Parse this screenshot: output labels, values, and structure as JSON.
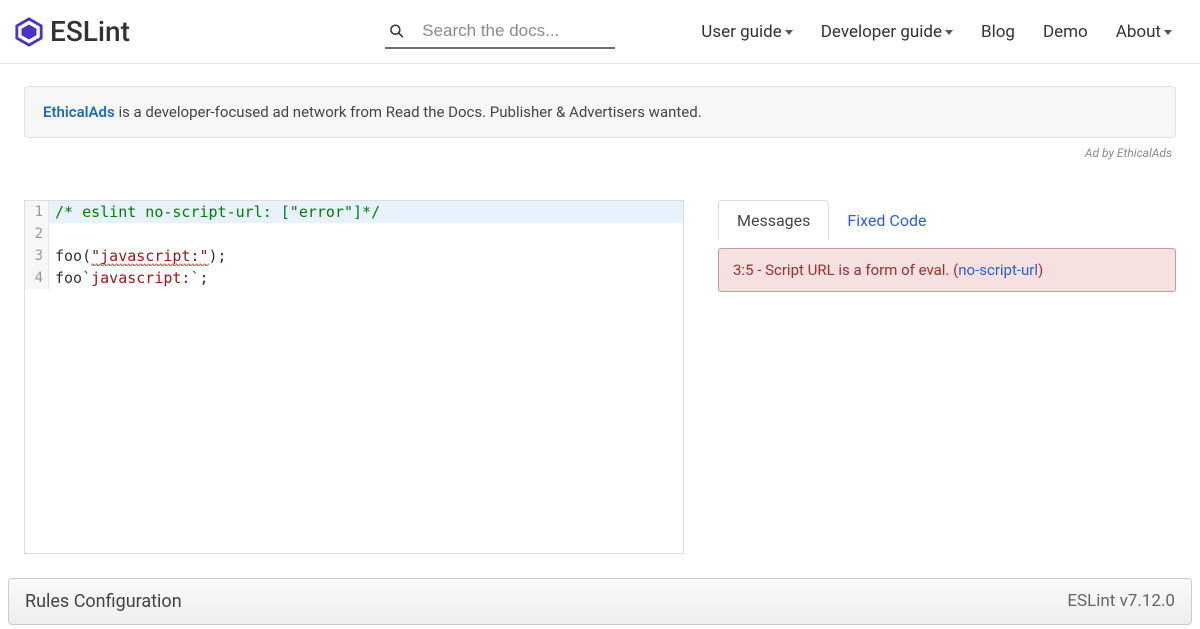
{
  "brand": {
    "name": "ESLint"
  },
  "search": {
    "placeholder": "Search the docs..."
  },
  "nav": {
    "userGuide": "User guide",
    "devGuide": "Developer guide",
    "blog": "Blog",
    "demo": "Demo",
    "about": "About"
  },
  "ad": {
    "link": "EthicalAds",
    "text": " is a developer-focused ad network from Read the Docs. Publisher & Advertisers wanted.",
    "by": "Ad by EthicalAds"
  },
  "editor": {
    "lines": [
      {
        "n": "1",
        "comment": "/* eslint no-script-url: [\"error\"]*/",
        "hl": true
      },
      {
        "n": "2"
      },
      {
        "n": "3",
        "pre": "foo(",
        "str": "\"javascript:\"",
        "post": ");",
        "error": true
      },
      {
        "n": "4",
        "pre": "foo`",
        "strplain": "javascript:",
        "post": "`;"
      }
    ]
  },
  "tabs": {
    "messages": "Messages",
    "fixed": "Fixed Code"
  },
  "message": {
    "loc": "3:5",
    "text": " - Script URL is a form of eval. ",
    "ruleOpen": "(",
    "rule": "no-script-url",
    "ruleClose": ")"
  },
  "footer": {
    "title": "Rules Configuration",
    "version": "ESLint v7.12.0"
  }
}
